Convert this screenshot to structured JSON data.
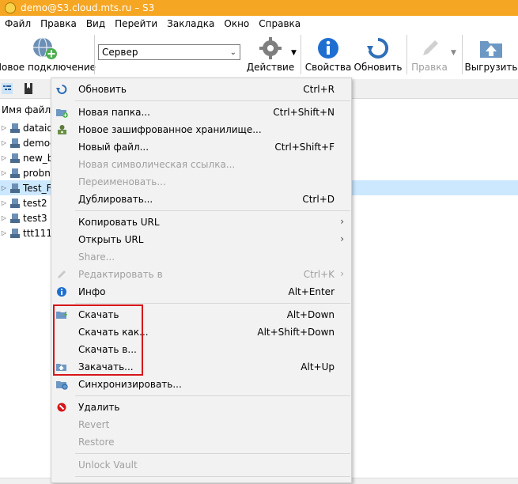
{
  "window": {
    "title": "demo@S3.cloud.mts.ru – S3"
  },
  "menubar": [
    "Файл",
    "Правка",
    "Вид",
    "Перейти",
    "Закладка",
    "Окно",
    "Справка"
  ],
  "toolbar": {
    "new_connection": "Новое подключение",
    "server_value": "Сервер",
    "action": "Действие",
    "properties": "Свойства",
    "refresh": "Обновить",
    "edit": "Правка",
    "upload": "Выгрузить"
  },
  "browser": {
    "column_name": "Имя файла",
    "files": [
      {
        "name": "dataiq",
        "selected": false
      },
      {
        "name": "democ",
        "selected": false
      },
      {
        "name": "new_b",
        "selected": false
      },
      {
        "name": "probno",
        "selected": false
      },
      {
        "name": "Test_Fo",
        "selected": true
      },
      {
        "name": "test2",
        "selected": false
      },
      {
        "name": "test3",
        "selected": false
      },
      {
        "name": "ttt111",
        "selected": false
      }
    ]
  },
  "context_menu": {
    "refresh": {
      "label": "Обновить",
      "shortcut": "Ctrl+R"
    },
    "new_folder": {
      "label": "Новая папка...",
      "shortcut": "Ctrl+Shift+N"
    },
    "new_vault": {
      "label": "Новое зашифрованное хранилище..."
    },
    "new_file": {
      "label": "Новый файл...",
      "shortcut": "Ctrl+Shift+F"
    },
    "new_symlink": {
      "label": "Новая символическая ссылка..."
    },
    "rename": {
      "label": "Переименовать..."
    },
    "duplicate": {
      "label": "Дублировать...",
      "shortcut": "Ctrl+D"
    },
    "copy_url": {
      "label": "Копировать URL"
    },
    "open_url": {
      "label": "Открыть URL"
    },
    "share": {
      "label": "Share..."
    },
    "edit_in": {
      "label": "Редактировать в",
      "shortcut": "Ctrl+K"
    },
    "info": {
      "label": "Инфо",
      "shortcut": "Alt+Enter"
    },
    "download": {
      "label": "Скачать",
      "shortcut": "Alt+Down"
    },
    "download_as": {
      "label": "Скачать как...",
      "shortcut": "Alt+Shift+Down"
    },
    "download_to": {
      "label": "Скачать в..."
    },
    "upload": {
      "label": "Закачать...",
      "shortcut": "Alt+Up"
    },
    "synchronize": {
      "label": "Синхронизировать..."
    },
    "delete": {
      "label": "Удалить"
    },
    "revert": {
      "label": "Revert"
    },
    "restore": {
      "label": "Restore"
    },
    "unlock_vault": {
      "label": "Unlock Vault"
    }
  },
  "colors": {
    "titlebar": "#f5a623",
    "highlight_box": "#d6151a",
    "selected_row": "#cce8ff",
    "menu_bg": "#f2f2f2"
  }
}
